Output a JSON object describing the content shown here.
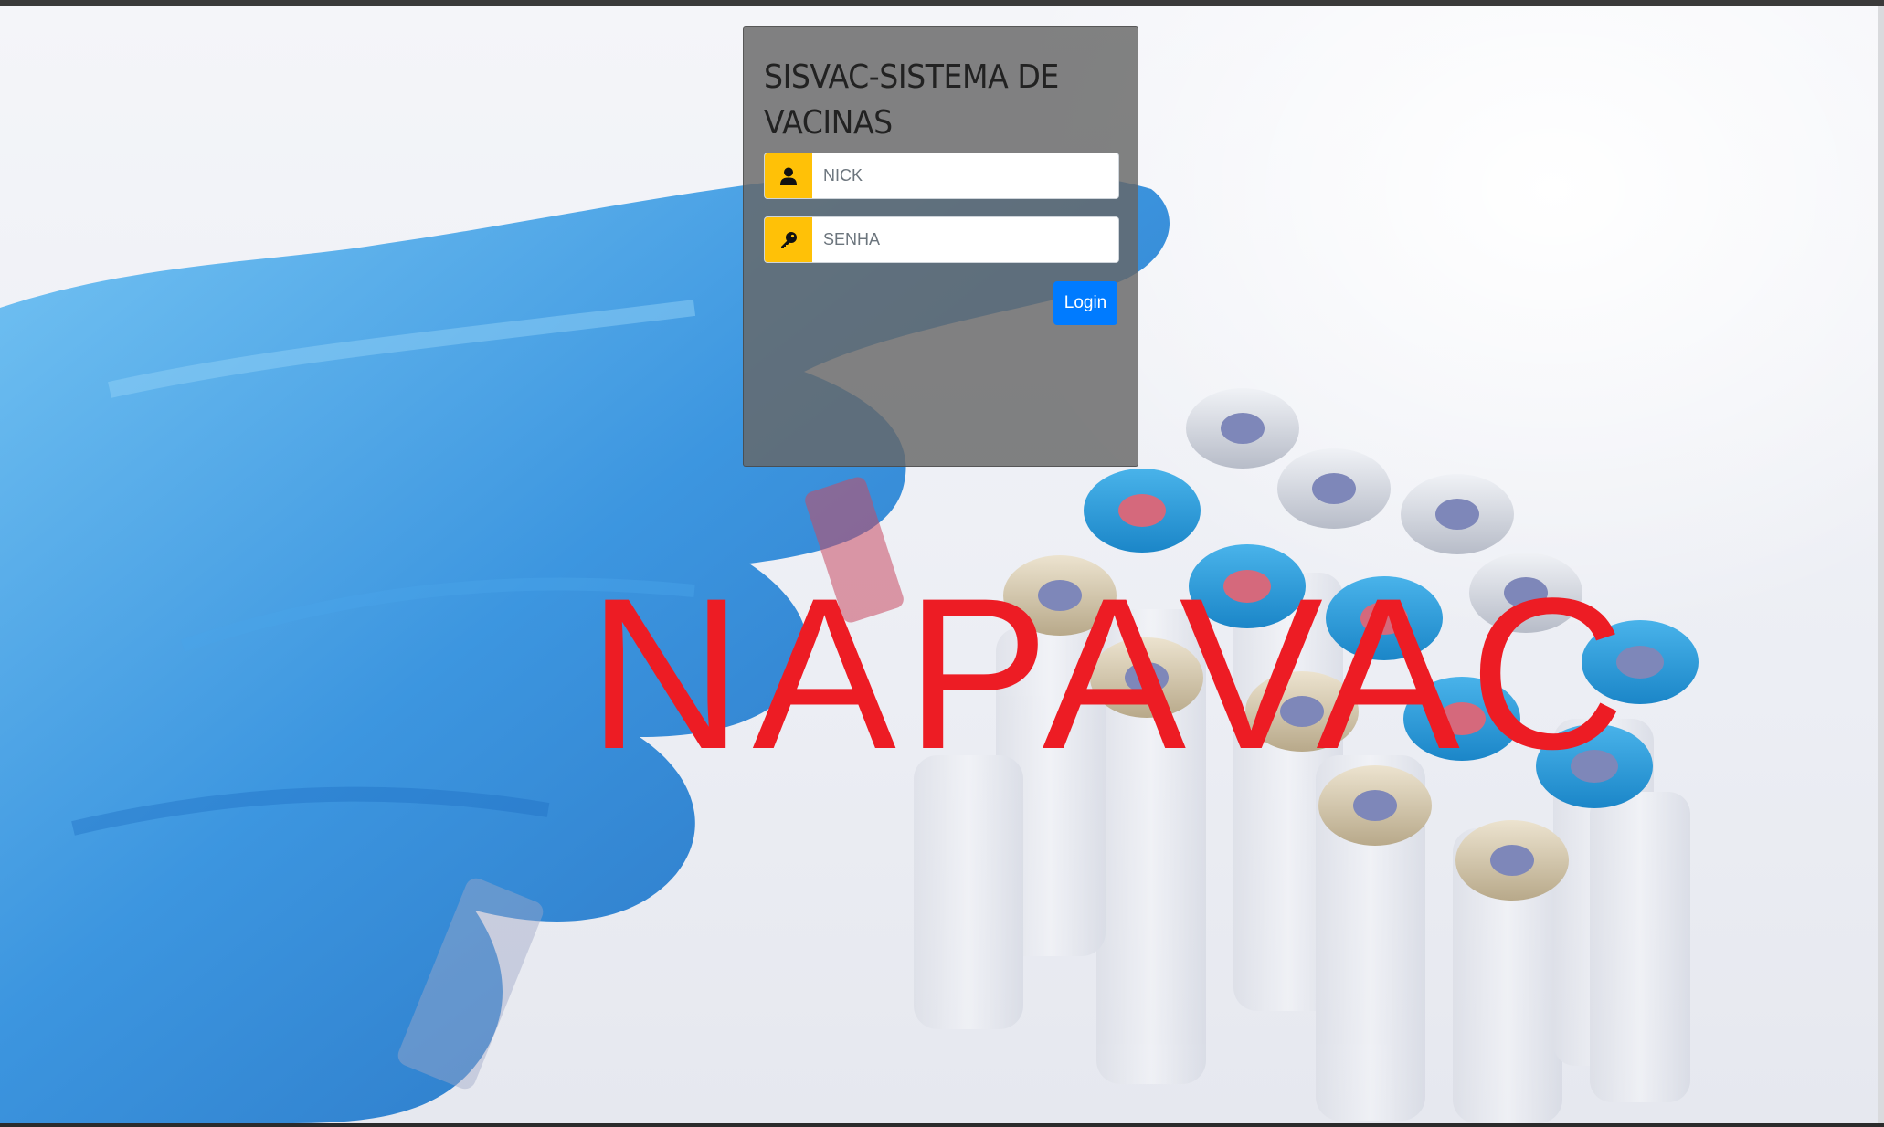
{
  "login": {
    "title": "SISVAC-SISTEMA DE VACINAS",
    "username": {
      "placeholder": "NICK",
      "value": "",
      "icon": "user-icon"
    },
    "password": {
      "placeholder": "SENHA",
      "value": "",
      "icon": "key-icon"
    },
    "submit_label": "Login"
  },
  "brand": {
    "text": "NAPAVAC"
  },
  "colors": {
    "input_addon": "#ffc107",
    "primary_button": "#007bff",
    "brand_text": "#ed1c24",
    "card_background": "#666666"
  }
}
